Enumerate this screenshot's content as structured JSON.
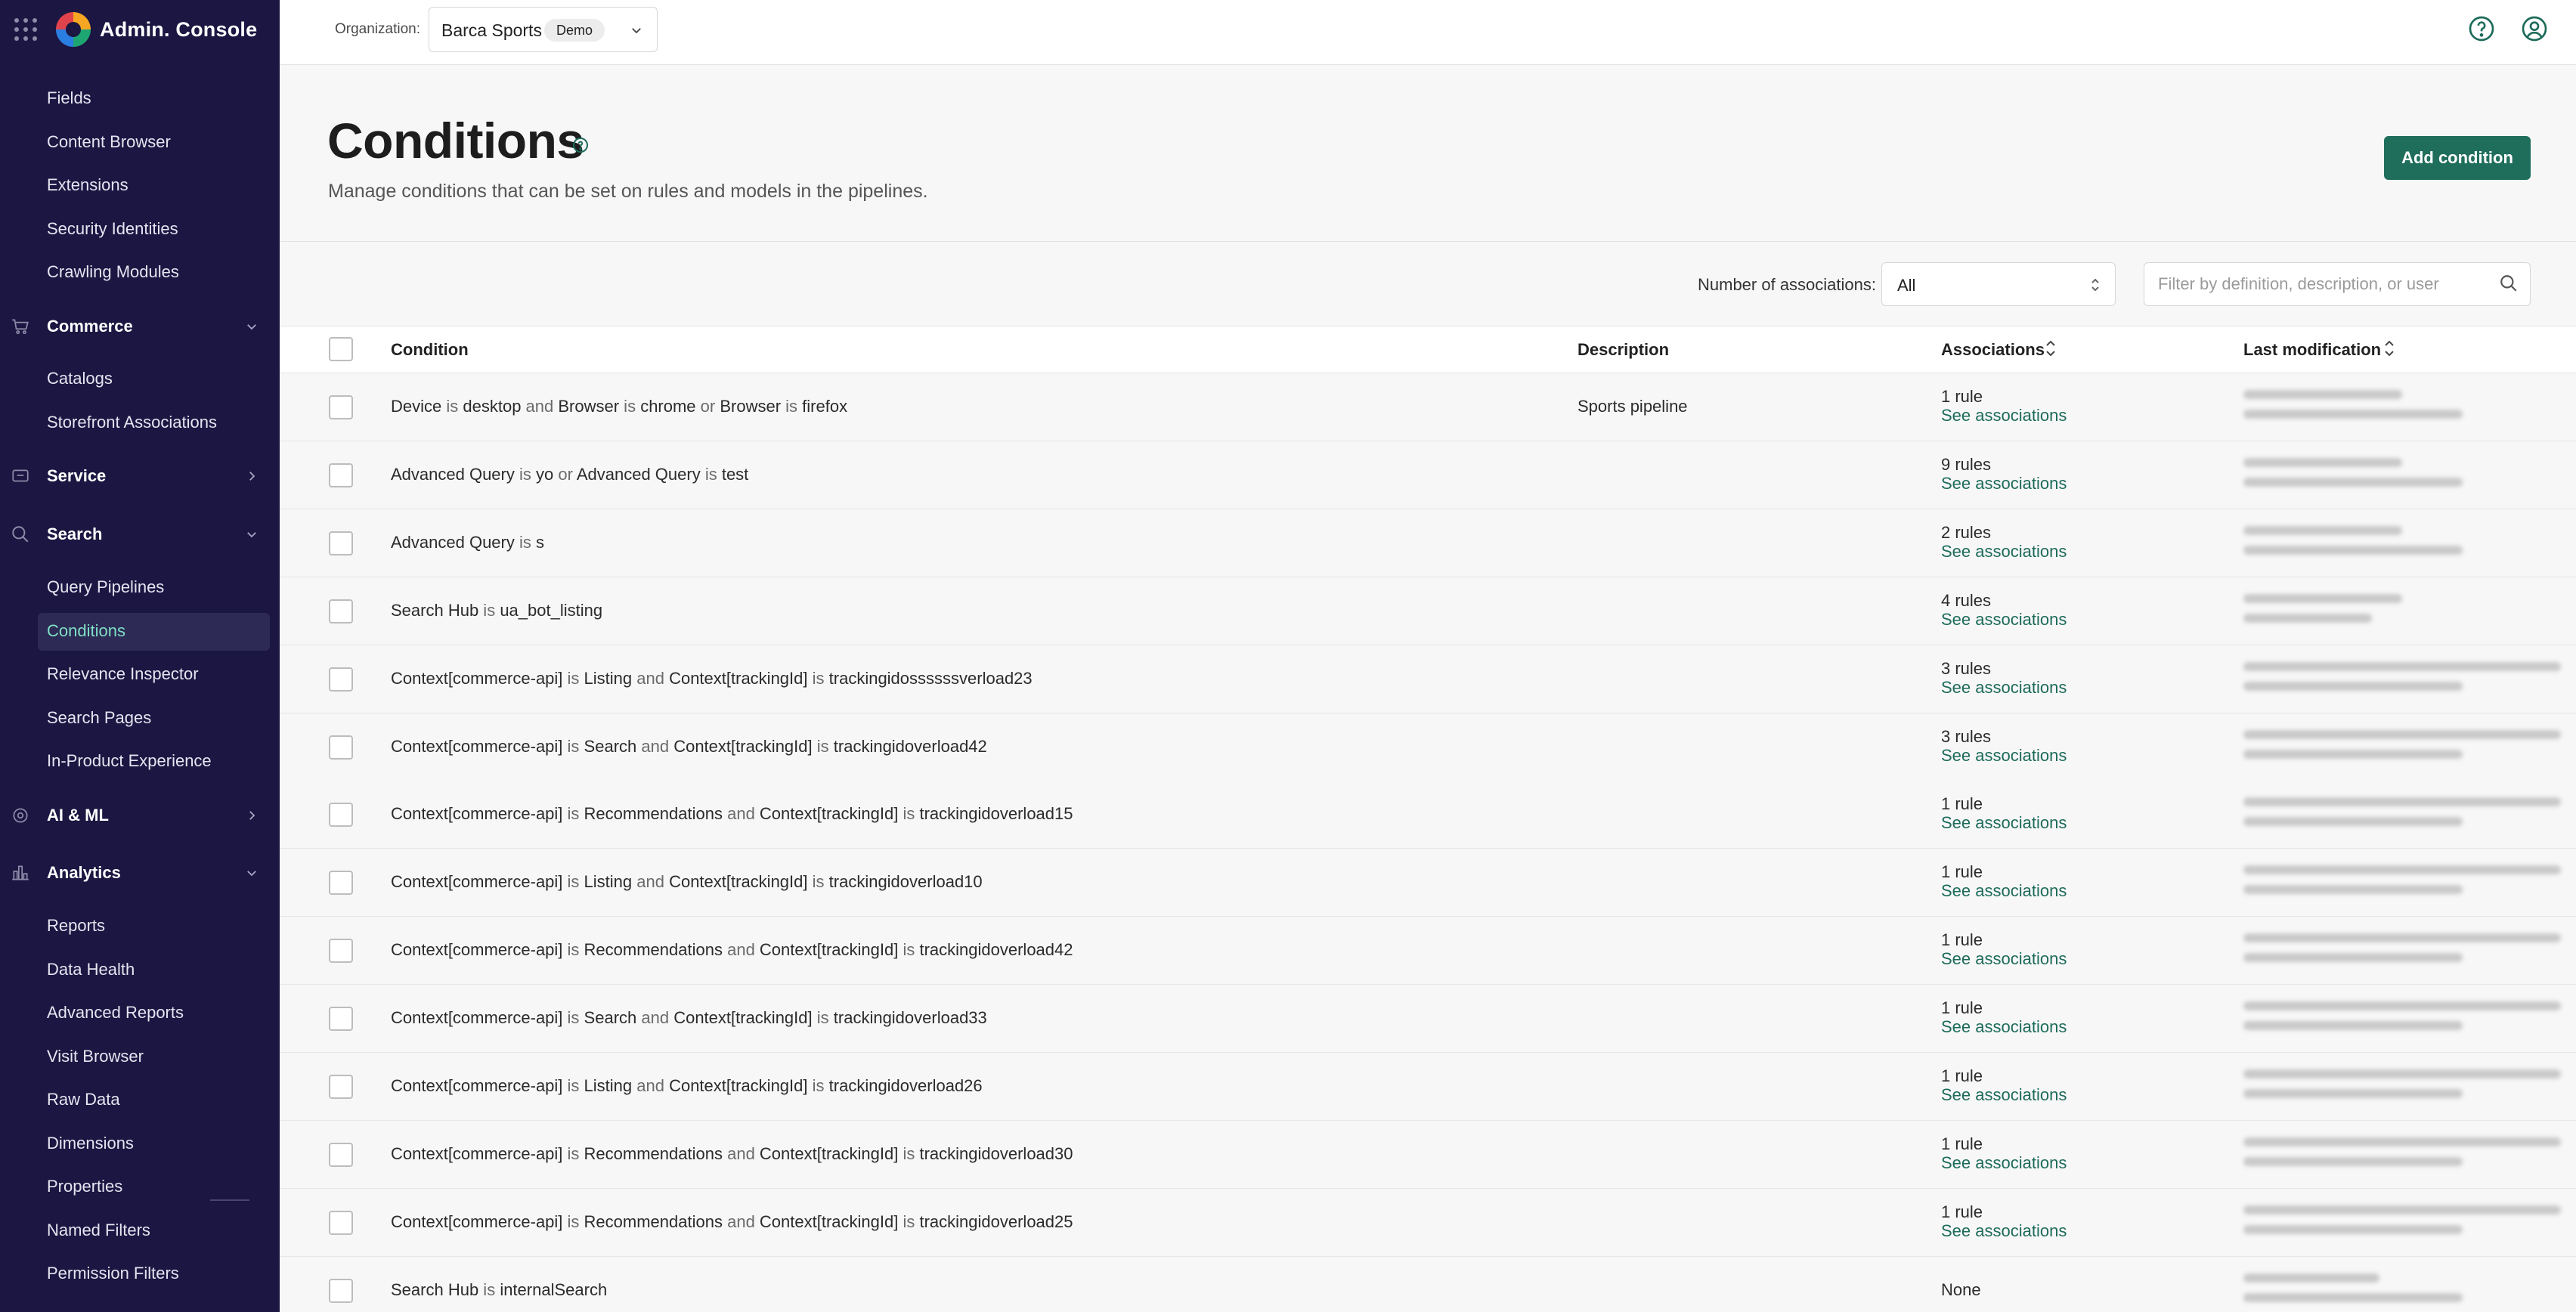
{
  "app": {
    "title": "Admin. Console"
  },
  "sidebar": {
    "top_items": [
      "Fields",
      "Content Browser",
      "Extensions",
      "Security Identities",
      "Crawling Modules"
    ],
    "sections": [
      {
        "label": "Commerce",
        "icon": "cart-icon",
        "expanded": true,
        "items": [
          "Catalogs",
          "Storefront Associations"
        ]
      },
      {
        "label": "Service",
        "icon": "service-icon",
        "expanded": false,
        "items": []
      },
      {
        "label": "Search",
        "icon": "search-icon",
        "expanded": true,
        "items": [
          "Query Pipelines",
          "Conditions",
          "Relevance Inspector",
          "Search Pages",
          "In-Product Experience"
        ],
        "active": "Conditions"
      },
      {
        "label": "AI & ML",
        "icon": "ai-icon",
        "expanded": false,
        "items": []
      },
      {
        "label": "Analytics",
        "icon": "analytics-icon",
        "expanded": true,
        "items": [
          "Reports",
          "Data Health",
          "Advanced Reports",
          "Visit Browser",
          "Raw Data",
          "Dimensions",
          "Properties",
          "Named Filters",
          "Permission Filters"
        ]
      }
    ]
  },
  "header": {
    "org_label": "Organization:",
    "org_name": "Barca Sports",
    "org_badge": "Demo"
  },
  "page": {
    "title": "Conditions",
    "subtitle": "Manage conditions that can be set on rules and models in the pipelines.",
    "add_button": "Add condition"
  },
  "filters": {
    "assoc_label": "Number of associations:",
    "assoc_value": "All",
    "search_placeholder": "Filter by definition, description, or user"
  },
  "table": {
    "columns": [
      "Condition",
      "Description",
      "Associations",
      "Last modification"
    ],
    "see_associations": "See associations",
    "rows": [
      {
        "condition": [
          [
            "Device",
            ""
          ],
          [
            " is ",
            "op"
          ],
          [
            "desktop",
            ""
          ],
          [
            " and ",
            "op"
          ],
          [
            "Browser",
            ""
          ],
          [
            " is ",
            "op"
          ],
          [
            "chrome",
            ""
          ],
          [
            " or ",
            "op"
          ],
          [
            "Browser",
            ""
          ],
          [
            " is ",
            "op"
          ],
          [
            "firefox",
            ""
          ]
        ],
        "description": "Sports pipeline",
        "associations": "1 rule",
        "link": true
      },
      {
        "condition": [
          [
            "Advanced Query",
            ""
          ],
          [
            " is ",
            "op"
          ],
          [
            "yo",
            ""
          ],
          [
            " or ",
            "op"
          ],
          [
            "Advanced Query",
            ""
          ],
          [
            " is ",
            "op"
          ],
          [
            "test",
            ""
          ]
        ],
        "description": "",
        "associations": "9 rules",
        "link": true
      },
      {
        "condition": [
          [
            "Advanced Query",
            ""
          ],
          [
            " is ",
            "op"
          ],
          [
            "s",
            ""
          ]
        ],
        "description": "",
        "associations": "2 rules",
        "link": true
      },
      {
        "condition": [
          [
            "Search Hub",
            ""
          ],
          [
            " is ",
            "op"
          ],
          [
            "ua_bot_listing",
            ""
          ]
        ],
        "description": "",
        "associations": "4 rules",
        "link": true
      },
      {
        "condition": [
          [
            "Context[commerce-api]",
            ""
          ],
          [
            " is ",
            "op"
          ],
          [
            "Listing",
            ""
          ],
          [
            " and ",
            "op"
          ],
          [
            "Context[trackingId]",
            ""
          ],
          [
            " is ",
            "op"
          ],
          [
            "trackingidossssssverload23",
            ""
          ]
        ],
        "description": "",
        "associations": "3 rules",
        "link": true
      },
      {
        "condition": [
          [
            "Context[commerce-api]",
            ""
          ],
          [
            " is ",
            "op"
          ],
          [
            "Search",
            ""
          ],
          [
            " and ",
            "op"
          ],
          [
            "Context[trackingId]",
            ""
          ],
          [
            " is ",
            "op"
          ],
          [
            "trackingidoverload42",
            ""
          ]
        ],
        "description": "",
        "associations": "3 rules",
        "link": true
      },
      {
        "condition": [
          [
            "Context[commerce-api]",
            ""
          ],
          [
            " is ",
            "op"
          ],
          [
            "Recommendations",
            ""
          ],
          [
            " and ",
            "op"
          ],
          [
            "Context[trackingId]",
            ""
          ],
          [
            " is ",
            "op"
          ],
          [
            "trackingidoverload15",
            ""
          ]
        ],
        "description": "",
        "associations": "1 rule",
        "link": true
      },
      {
        "condition": [
          [
            "Context[commerce-api]",
            ""
          ],
          [
            " is ",
            "op"
          ],
          [
            "Listing",
            ""
          ],
          [
            " and ",
            "op"
          ],
          [
            "Context[trackingId]",
            ""
          ],
          [
            " is ",
            "op"
          ],
          [
            "trackingidoverload10",
            ""
          ]
        ],
        "description": "",
        "associations": "1 rule",
        "link": true
      },
      {
        "condition": [
          [
            "Context[commerce-api]",
            ""
          ],
          [
            " is ",
            "op"
          ],
          [
            "Recommendations",
            ""
          ],
          [
            " and ",
            "op"
          ],
          [
            "Context[trackingId]",
            ""
          ],
          [
            " is ",
            "op"
          ],
          [
            "trackingidoverload42",
            ""
          ]
        ],
        "description": "",
        "associations": "1 rule",
        "link": true
      },
      {
        "condition": [
          [
            "Context[commerce-api]",
            ""
          ],
          [
            " is ",
            "op"
          ],
          [
            "Search",
            ""
          ],
          [
            " and ",
            "op"
          ],
          [
            "Context[trackingId]",
            ""
          ],
          [
            " is ",
            "op"
          ],
          [
            "trackingidoverload33",
            ""
          ]
        ],
        "description": "",
        "associations": "1 rule",
        "link": true
      },
      {
        "condition": [
          [
            "Context[commerce-api]",
            ""
          ],
          [
            " is ",
            "op"
          ],
          [
            "Listing",
            ""
          ],
          [
            " and ",
            "op"
          ],
          [
            "Context[trackingId]",
            ""
          ],
          [
            " is ",
            "op"
          ],
          [
            "trackingidoverload26",
            ""
          ]
        ],
        "description": "",
        "associations": "1 rule",
        "link": true
      },
      {
        "condition": [
          [
            "Context[commerce-api]",
            ""
          ],
          [
            " is ",
            "op"
          ],
          [
            "Recommendations",
            ""
          ],
          [
            " and ",
            "op"
          ],
          [
            "Context[trackingId]",
            ""
          ],
          [
            " is ",
            "op"
          ],
          [
            "trackingidoverload30",
            ""
          ]
        ],
        "description": "",
        "associations": "1 rule",
        "link": true
      },
      {
        "condition": [
          [
            "Context[commerce-api]",
            ""
          ],
          [
            " is ",
            "op"
          ],
          [
            "Recommendations",
            ""
          ],
          [
            " and ",
            "op"
          ],
          [
            "Context[trackingId]",
            ""
          ],
          [
            " is ",
            "op"
          ],
          [
            "trackingidoverload25",
            ""
          ]
        ],
        "description": "",
        "associations": "1 rule",
        "link": true
      },
      {
        "condition": [
          [
            "Search Hub",
            ""
          ],
          [
            " is ",
            "op"
          ],
          [
            "internalSearch",
            ""
          ]
        ],
        "description": "",
        "associations": "None",
        "link": false
      }
    ]
  },
  "colors": {
    "sidebar_bg": "#1b1642",
    "accent": "#1d6b5a",
    "active_text": "#7fe0c4"
  }
}
